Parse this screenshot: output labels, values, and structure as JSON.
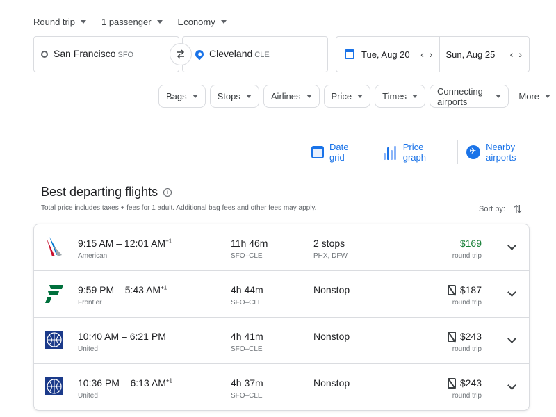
{
  "trip": {
    "type_label": "Round trip",
    "passengers_label": "1 passenger",
    "class_label": "Economy"
  },
  "search": {
    "origin_city": "San Francisco",
    "origin_code": "SFO",
    "destination_city": "Cleveland",
    "destination_code": "CLE",
    "depart_date": "Tue, Aug 20",
    "return_date": "Sun, Aug 25"
  },
  "filters": [
    "Bags",
    "Stops",
    "Airlines",
    "Price",
    "Times",
    "Connecting airports"
  ],
  "more_label": "More",
  "tools": {
    "date_grid": "Date grid",
    "price_graph": "Price graph",
    "nearby_airports": "Nearby airports"
  },
  "results_header": {
    "title": "Best departing flights",
    "subtext_prefix": "Total price includes taxes + fees for 1 adult. ",
    "subtext_link": "Additional bag fees",
    "subtext_suffix": " and other fees may apply.",
    "sort_label": "Sort by:"
  },
  "flights": [
    {
      "times": "9:15 AM – 12:01 AM",
      "plus_day": "+1",
      "airline": "American",
      "duration": "11h 46m",
      "route": "SFO–CLE",
      "stops": "2 stops",
      "stop_codes": "PHX, DFW",
      "price": "$169",
      "price_type": "round trip"
    },
    {
      "times": "9:59 PM – 5:43 AM",
      "plus_day": "+1",
      "airline": "Frontier",
      "duration": "4h 44m",
      "route": "SFO–CLE",
      "stops": "Nonstop",
      "stop_codes": "",
      "price": "$187",
      "price_type": "round trip"
    },
    {
      "times": "10:40 AM – 6:21 PM",
      "plus_day": "",
      "airline": "United",
      "duration": "4h 41m",
      "route": "SFO–CLE",
      "stops": "Nonstop",
      "stop_codes": "",
      "price": "$243",
      "price_type": "round trip"
    },
    {
      "times": "10:36 PM – 6:13 AM",
      "plus_day": "+1",
      "airline": "United",
      "duration": "4h 37m",
      "route": "SFO–CLE",
      "stops": "Nonstop",
      "stop_codes": "",
      "price": "$243",
      "price_type": "round trip"
    }
  ],
  "colors": {
    "accent": "#1a73e8",
    "price_low": "#188038",
    "border": "#dadce0"
  }
}
